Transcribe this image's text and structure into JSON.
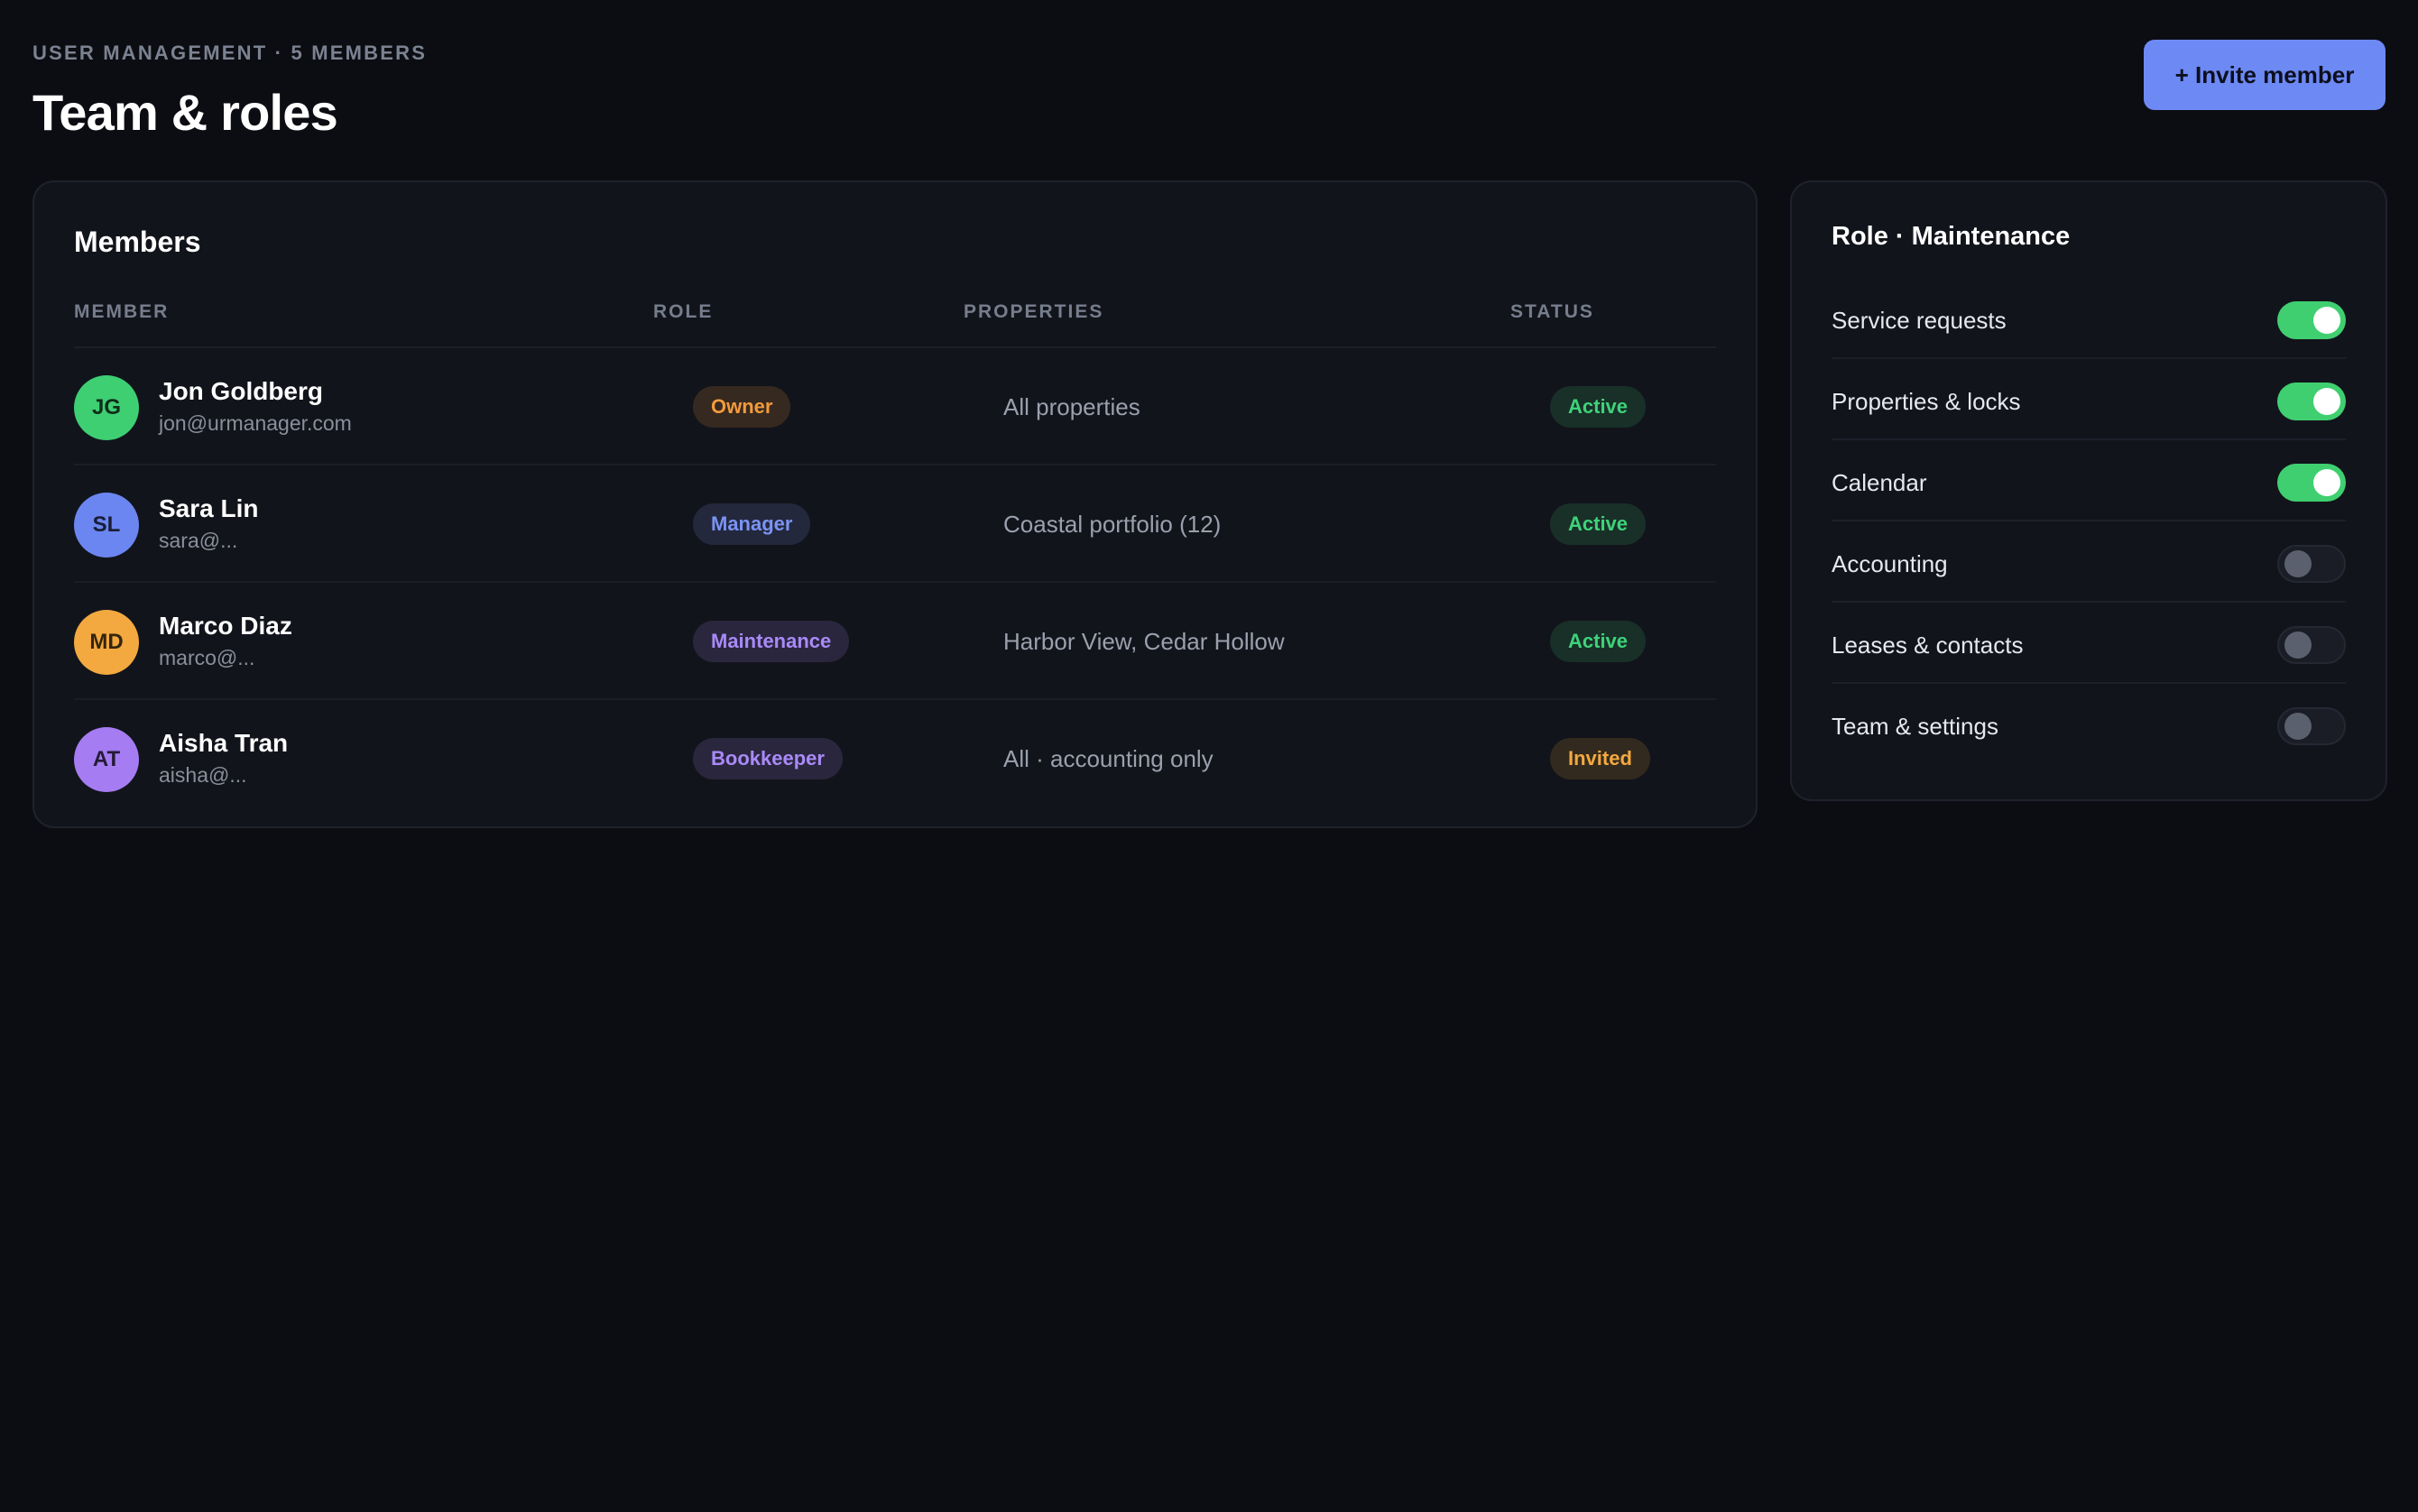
{
  "header": {
    "eyebrow": "USER MANAGEMENT · 5 MEMBERS",
    "title": "Team & roles",
    "invite_label": "+ Invite member"
  },
  "members": {
    "title": "Members",
    "columns": [
      "MEMBER",
      "ROLE",
      "PROPERTIES",
      "STATUS"
    ],
    "rows": [
      {
        "initials": "JG",
        "name": "Jon Goldberg",
        "email": "jon@urmanager.com",
        "role": "Owner",
        "properties": "All properties",
        "status": "Active",
        "avatar_color": "#3ecf73",
        "role_color": "#f39a3c",
        "status_color": "#3fd27a"
      },
      {
        "initials": "SL",
        "name": "Sara Lin",
        "email": "sara@...",
        "role": "Manager",
        "properties": "Coastal portfolio (12)",
        "status": "Active",
        "avatar_color": "#6b86f0",
        "role_color": "#7b93f4",
        "status_color": "#3fd27a"
      },
      {
        "initials": "MD",
        "name": "Marco Diaz",
        "email": "marco@...",
        "role": "Maintenance",
        "properties": "Harbor View, Cedar Hollow",
        "status": "Active",
        "avatar_color": "#f3a93f",
        "role_color": "#a98af8",
        "status_color": "#3fd27a"
      },
      {
        "initials": "AT",
        "name": "Aisha Tran",
        "email": "aisha@...",
        "role": "Bookkeeper",
        "properties": "All · accounting only",
        "status": "Invited",
        "avatar_color": "#a57cf2",
        "role_color": "#a98af8",
        "status_color": "#f3a93f"
      }
    ]
  },
  "role_panel": {
    "title": "Role · Maintenance",
    "permissions": [
      {
        "label": "Service requests",
        "enabled": true
      },
      {
        "label": "Properties & locks",
        "enabled": true
      },
      {
        "label": "Calendar",
        "enabled": true
      },
      {
        "label": "Accounting",
        "enabled": false
      },
      {
        "label": "Leases & contacts",
        "enabled": false
      },
      {
        "label": "Team & settings",
        "enabled": false
      }
    ]
  },
  "colors": {
    "background": "#0c0d12",
    "panel": "#12141b",
    "accent": "#6d89f4",
    "toggle_on": "#3fcf70"
  }
}
